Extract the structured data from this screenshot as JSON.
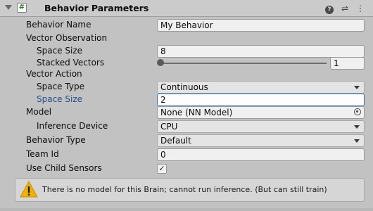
{
  "header": {
    "icon_glyph": "#",
    "title": "Behavior Parameters",
    "help_glyph": "?",
    "preset_glyph": "⇌",
    "menu_glyph": "⋮"
  },
  "fields": {
    "behavior_name": {
      "label": "Behavior Name",
      "value": "My Behavior"
    },
    "vector_observation": {
      "label": "Vector Observation"
    },
    "space_size_obs": {
      "label": "Space Size",
      "value": "8"
    },
    "stacked_vectors": {
      "label": "Stacked Vectors",
      "value": "1",
      "slider_fraction": 0.0
    },
    "vector_action": {
      "label": "Vector Action"
    },
    "space_type": {
      "label": "Space Type",
      "value": "Continuous"
    },
    "space_size_act": {
      "label": "Space Size",
      "value": "2"
    },
    "model": {
      "label": "Model",
      "value": "None (NN Model)"
    },
    "inference_device": {
      "label": "Inference Device",
      "value": "CPU"
    },
    "behavior_type": {
      "label": "Behavior Type",
      "value": "Default"
    },
    "team_id": {
      "label": "Team Id",
      "value": "0"
    },
    "use_child_sensors": {
      "label": "Use Child Sensors",
      "checked": true,
      "check_glyph": "✓"
    }
  },
  "help_box": {
    "icon": "warning-icon",
    "text": "There is no model for this Brain; cannot run inference. (But can still train)"
  },
  "colors": {
    "background": "#c2c2c2",
    "focused_label": "#244f8e",
    "warning": "#f0b400"
  }
}
